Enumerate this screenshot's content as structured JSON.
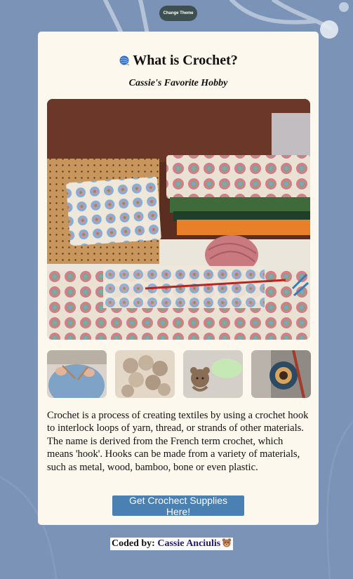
{
  "theme_button": {
    "label": "Change Theme"
  },
  "card": {
    "title": "What is Crochet?",
    "title_icon": "yarn-ball-icon",
    "subtitle": "Cassie's Favorite Hobby",
    "hero_image": "crochet-granny-squares-photo",
    "thumbnails": [
      "knitting-person-photo",
      "bobble-crochet-sweater-photo",
      "crochet-amigurumi-photo",
      "crochet-bag-photo"
    ],
    "description": "Crochet is a process of creating textiles by using a crochet hook to interlock loops of yarn, thread, or strands of other materials. The name is derived from the French term crochet, which means 'hook'. Hooks can be made from a variety of materials, such as metal, wood, bamboo, bone or even plastic.",
    "cta_label": "Get Crochect Supplies Here!"
  },
  "footer": {
    "prefix": "Coded by:",
    "author": "Cassie Anciulis",
    "author_icon": "bear-face-icon"
  },
  "colors": {
    "background": "#7b93b6",
    "card": "#fdf8ee",
    "button": "#4a80b2",
    "theme_button": "#3d4f4e",
    "link": "#1f1a6b"
  }
}
